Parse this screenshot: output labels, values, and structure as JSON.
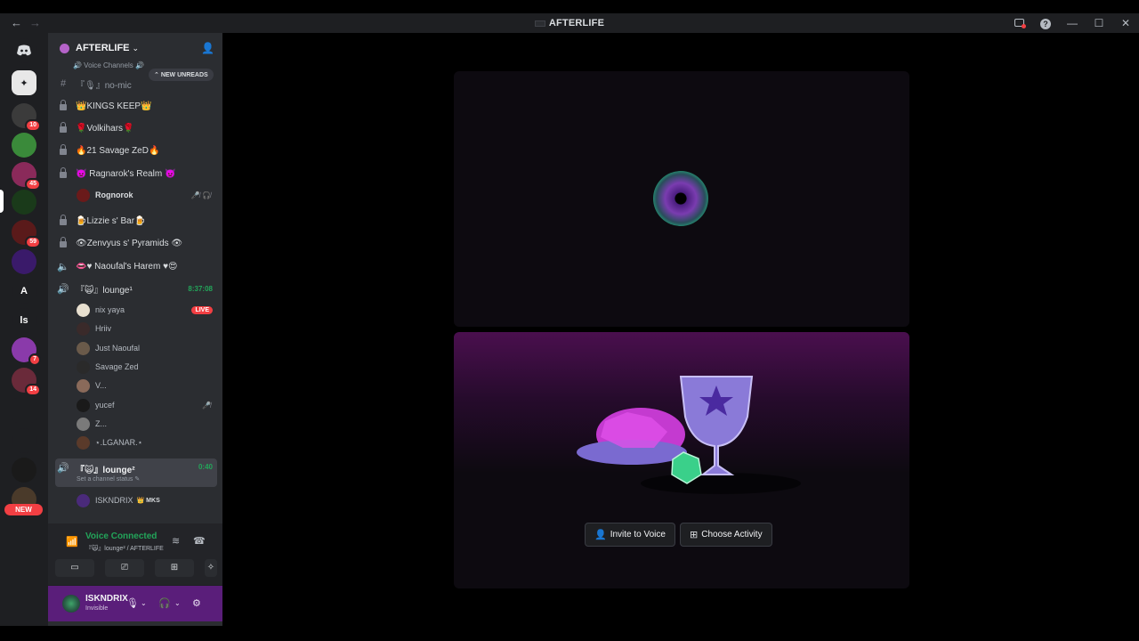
{
  "window": {
    "title": "AFTERLIFE",
    "nav_back": "←",
    "nav_forward": "→",
    "minimize": "—",
    "maximize": "☐",
    "close": "✕",
    "help": "?"
  },
  "rail": {
    "home_icon": "discord-logo-icon",
    "servers": [
      {
        "name": "explore-server",
        "label": "✦",
        "badge": null,
        "color": "#e8e8e8"
      },
      {
        "name": "server-1",
        "label": "",
        "badge": "10",
        "color": "#3b3b3b"
      },
      {
        "name": "server-2",
        "label": "",
        "badge": null,
        "color": "#3a8a3a"
      },
      {
        "name": "server-3",
        "label": "",
        "badge": "45",
        "color": "#8a2a5a"
      },
      {
        "name": "server-afterlife",
        "label": "",
        "badge": null,
        "color": "#1a3a1a"
      },
      {
        "name": "server-5",
        "label": "",
        "badge": "59",
        "color": "#5a1a1a"
      },
      {
        "name": "server-6",
        "label": "",
        "badge": null,
        "color": "#3a1a6a"
      },
      {
        "name": "server-a",
        "label": "A",
        "badge": null,
        "color": "#1e1f22"
      },
      {
        "name": "server-ls",
        "label": "ls",
        "badge": null,
        "color": "#1e1f22"
      },
      {
        "name": "server-9",
        "label": "",
        "badge": "7",
        "color": "#8a3aaa"
      },
      {
        "name": "server-10",
        "label": "",
        "badge": "14",
        "color": "#6a2a3a"
      },
      {
        "name": "server-folder",
        "label": "",
        "badge": null,
        "color": "#1e1f22"
      },
      {
        "name": "server-12",
        "label": "",
        "badge": null,
        "color": "#1e1f22"
      },
      {
        "name": "server-13",
        "label": "",
        "badge": null,
        "color": "#1a1a1a"
      },
      {
        "name": "server-14",
        "label": "",
        "badge": null,
        "color": "#4a3a2a"
      }
    ],
    "new_label": "NEW"
  },
  "sidebar": {
    "guild_name": "AFTERLIFE",
    "category_peek": "🔊 Voice Channels 🔊",
    "new_unreads": "NEW UNREADS",
    "channels": [
      {
        "label": "『🎙』no-mic",
        "type": "text"
      },
      {
        "label": "👑KINGS KEEP👑",
        "type": "locked"
      },
      {
        "label": "🌹Volkihars🌹",
        "type": "locked"
      },
      {
        "label": "🔥21 Savage ZeD🔥",
        "type": "locked"
      },
      {
        "label": "👿 Ragnarok's Realm 👿",
        "type": "locked"
      },
      {
        "label": "🍺Lizzie s' Bar🍺",
        "type": "locked"
      },
      {
        "label": "👁Zenvyus s' Pyramids 👁",
        "type": "locked"
      },
      {
        "label": "👄♥ Naoufal's Harem ♥😍",
        "type": "voice"
      },
      {
        "label": "『🙀』lounge¹",
        "type": "voice-active",
        "time": "8:37:08"
      },
      {
        "label": "『🙀』lounge²",
        "type": "voice-current",
        "time": "0:40",
        "status": "Set a channel status ✎"
      }
    ],
    "ragnarok_users": [
      {
        "name": "Rognorok"
      }
    ],
    "lounge1_users": [
      {
        "name": "nix yaya",
        "live": "LIVE"
      },
      {
        "name": "Hriiv"
      },
      {
        "name": "Just Naoufal"
      },
      {
        "name": "Savage Zed"
      },
      {
        "name": "V..."
      },
      {
        "name": "yucef"
      },
      {
        "name": "Z..."
      },
      {
        "name": "⋆.LGANAR.⋆"
      }
    ],
    "lounge2_users": [
      {
        "name": "ISKNDRIX",
        "tag": "👑 MKS"
      }
    ]
  },
  "voice_panel": {
    "title": "Voice Connected",
    "subtitle": "『🙀』lounge² / AFTERLIFE"
  },
  "user_panel": {
    "name": "ISKNDRIX",
    "status": "Invisible"
  },
  "stage": {
    "invite_label": "Invite to Voice",
    "activity_label": "Choose Activity"
  },
  "colors": {
    "accent_green": "#23a55a",
    "live_red": "#f23f43",
    "user_panel_bg": "#5a1e7a"
  }
}
